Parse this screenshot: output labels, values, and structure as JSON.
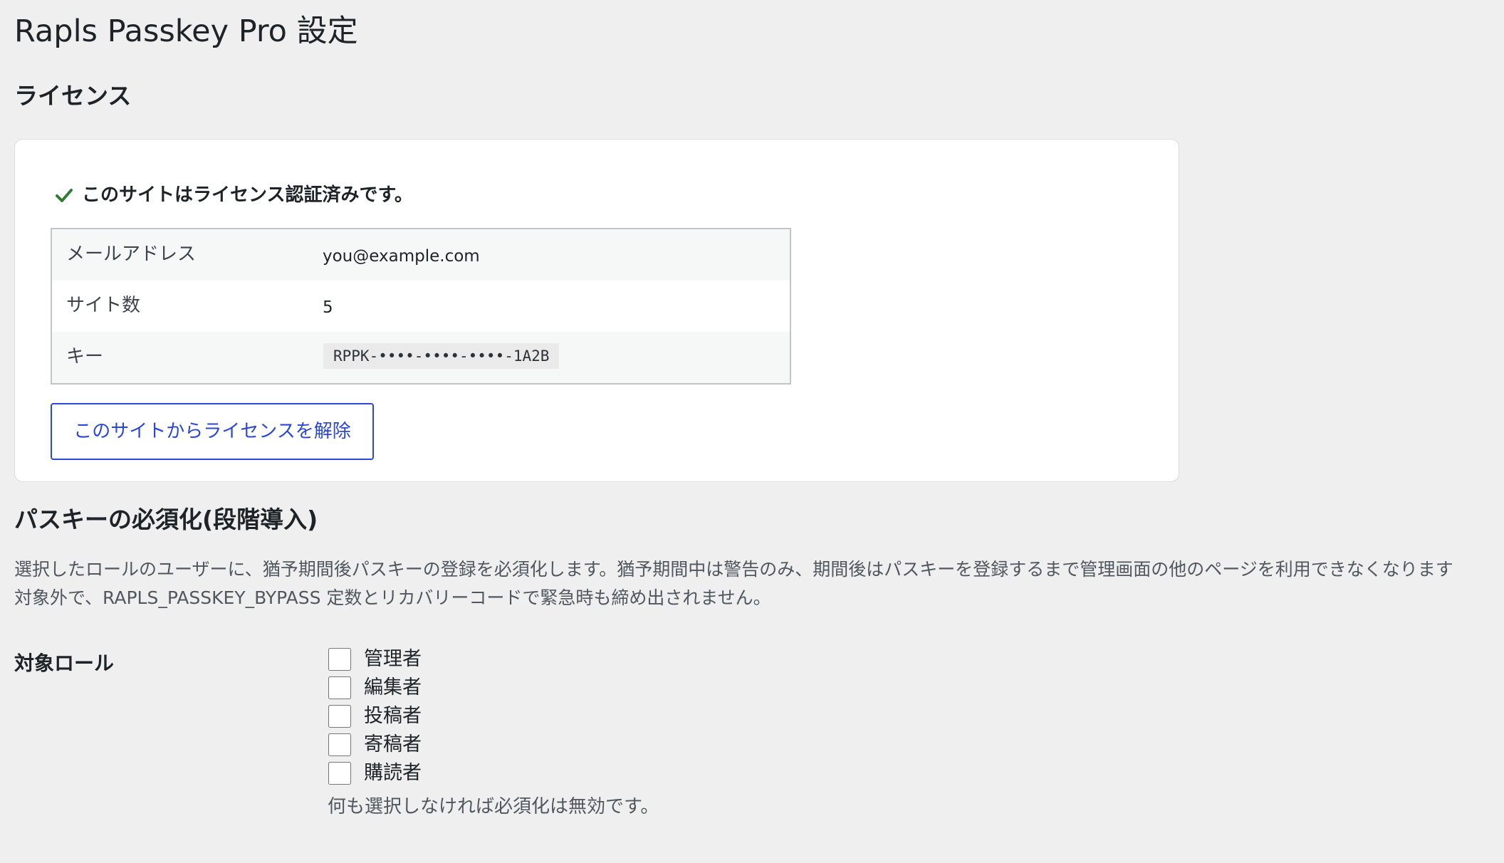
{
  "page": {
    "title": "Rapls Passkey Pro 設定"
  },
  "license": {
    "heading": "ライセンス",
    "status_icon": "check-icon",
    "status_color": "#2e7d32",
    "status_text": "このサイトはライセンス認証済みです。",
    "rows": [
      {
        "label": "メールアドレス",
        "value": "you@example.com"
      },
      {
        "label": "サイト数",
        "value": "5"
      },
      {
        "label": "キー",
        "value": "RPPK-••••-••••-••••-1A2B"
      }
    ],
    "deactivate_label": "このサイトからライセンスを解除",
    "button_color": "#2c47d8"
  },
  "passkey_enforcement": {
    "heading": "パスキーの必須化(段階導入)",
    "description_lines": [
      "選択したロールのユーザーに、猶予期間後パスキーの登録を必須化します。猶予期間中は警告のみ、期間後はパスキーを登録するまで管理画面の他のページを利用できなくなります",
      "対象外で、RAPLS_PASSKEY_BYPASS 定数とリカバリーコードで緊急時も締め出されません。"
    ],
    "roles_label": "対象ロール",
    "roles": [
      {
        "label": "管理者",
        "checked": false
      },
      {
        "label": "編集者",
        "checked": false
      },
      {
        "label": "投稿者",
        "checked": false
      },
      {
        "label": "寄稿者",
        "checked": false
      },
      {
        "label": "購読者",
        "checked": false
      }
    ],
    "roles_note": "何も選択しなければ必須化は無効です。"
  }
}
